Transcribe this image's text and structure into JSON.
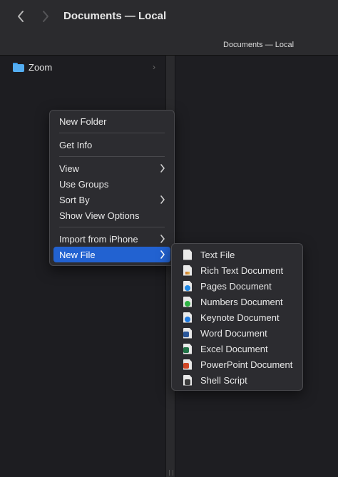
{
  "window": {
    "title": "Documents — Local",
    "path_title": "Documents — Local"
  },
  "sidebar": {
    "items": [
      {
        "label": "Zoom",
        "icon": "folder-icon",
        "color": "#54aef3"
      }
    ]
  },
  "context_menu": {
    "items": [
      {
        "label": "New Folder"
      },
      {
        "label": "Get Info"
      },
      {
        "label": "View",
        "submenu": true
      },
      {
        "label": "Use Groups"
      },
      {
        "label": "Sort By",
        "submenu": true
      },
      {
        "label": "Show View Options"
      },
      {
        "label": "Import from iPhone",
        "submenu": true
      },
      {
        "label": "New File",
        "submenu": true,
        "highlighted": true
      }
    ]
  },
  "new_file_submenu": {
    "items": [
      {
        "label": "Text File",
        "icon": "text-file-icon"
      },
      {
        "label": "Rich Text Document",
        "icon": "rich-text-icon"
      },
      {
        "label": "Pages Document",
        "icon": "pages-icon",
        "color": "#1e88e5"
      },
      {
        "label": "Numbers Document",
        "icon": "numbers-icon",
        "color": "#2fb344"
      },
      {
        "label": "Keynote Document",
        "icon": "keynote-icon",
        "color": "#1f7ae0"
      },
      {
        "label": "Word Document",
        "icon": "word-icon",
        "color": "#2b579a"
      },
      {
        "label": "Excel Document",
        "icon": "excel-icon",
        "color": "#217346"
      },
      {
        "label": "PowerPoint Document",
        "icon": "powerpoint-icon",
        "color": "#d24726"
      },
      {
        "label": "Shell Script",
        "icon": "shell-script-icon",
        "color": "#3c3c3c"
      }
    ]
  },
  "colors": {
    "highlight": "#2262d1",
    "toolbar": "#2b2b2e",
    "background": "#1e1e22"
  }
}
